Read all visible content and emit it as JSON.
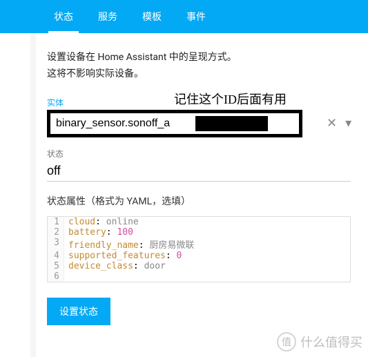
{
  "tabs": {
    "t0": "状态",
    "t1": "服务",
    "t2": "模板",
    "t3": "事件"
  },
  "desc": {
    "line1": "设置设备在 Home Assistant 中的呈现方式。",
    "line2": "这将不影响实际设备。"
  },
  "annotation": "记住这个ID后面有用",
  "entity": {
    "label": "实体",
    "value": "binary_sensor.sonoff_a"
  },
  "state": {
    "label": "状态",
    "value": "off"
  },
  "attrs": {
    "label": "状态属性（格式为 YAML，选填）",
    "lines": {
      "l1k": "cloud",
      "l1v": "online",
      "l2k": "battery",
      "l2v": "100",
      "l3k": "friendly_name",
      "l3v": "厨房易微联",
      "l4k": "supported_features",
      "l4v": "0",
      "l5k": "device_class",
      "l5v": "door"
    }
  },
  "button": {
    "set": "设置状态"
  },
  "watermark": {
    "icon": "值",
    "text": "什么值得买"
  }
}
